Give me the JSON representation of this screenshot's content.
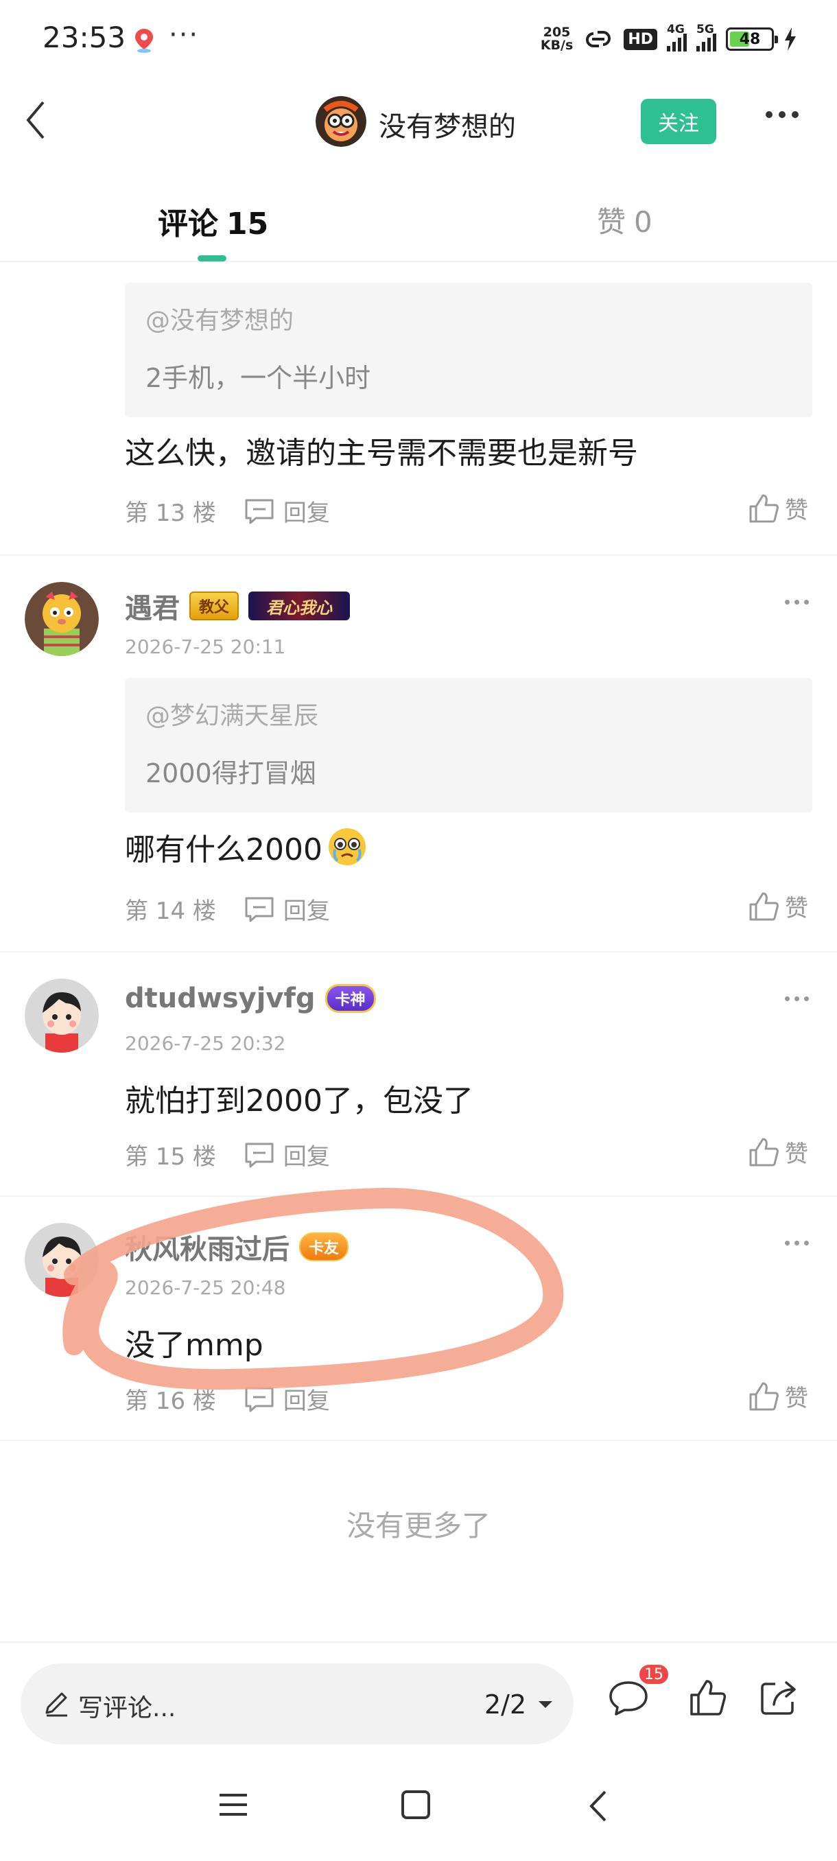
{
  "status_bar": {
    "time": "23:53",
    "dots": "···",
    "net_speed_value": "205",
    "net_speed_unit": "KB/s",
    "hd_label": "HD",
    "sim1_label": "4G",
    "sim2_label": "5G",
    "battery_level": "48"
  },
  "header": {
    "title": "没有梦想的",
    "follow_label": "关注"
  },
  "tabs": {
    "comments_label": "评论",
    "comments_count": "15",
    "likes_label": "赞",
    "likes_count": "0"
  },
  "comments": [
    {
      "quote_user": "@没有梦想的",
      "quote_text": "2手机，一个半小时",
      "text": "这么快，邀请的主号需不需要也是新号",
      "floor": "第 13 楼",
      "reply_label": "回复",
      "like_label": "赞"
    },
    {
      "username": "遇君",
      "badge1": "教父",
      "badge2": "君心我心",
      "time": "2026-7-25 20:11",
      "quote_user": "@梦幻满天星辰",
      "quote_text": "2000得打冒烟",
      "text": "哪有什么2000",
      "floor": "第 14 楼",
      "reply_label": "回复",
      "like_label": "赞"
    },
    {
      "username": "dtudwsyjvfg",
      "badge1": "卡神",
      "time": "2026-7-25 20:32",
      "text": "就怕打到2000了，包没了",
      "floor": "第 15 楼",
      "reply_label": "回复",
      "like_label": "赞"
    },
    {
      "username": "秋风秋雨过后",
      "badge1": "卡友",
      "time": "2026-7-25 20:48",
      "text": "没了mmp",
      "floor": "第 16 楼",
      "reply_label": "回复",
      "like_label": "赞"
    }
  ],
  "no_more_text": "没有更多了",
  "bottom_bar": {
    "input_placeholder": "写评论...",
    "page_indicator": "2/2",
    "comment_count_badge": "15"
  },
  "colors": {
    "accent": "#2ec093",
    "badge_red": "#f04646",
    "annotation_stroke": "#f4a48c"
  }
}
